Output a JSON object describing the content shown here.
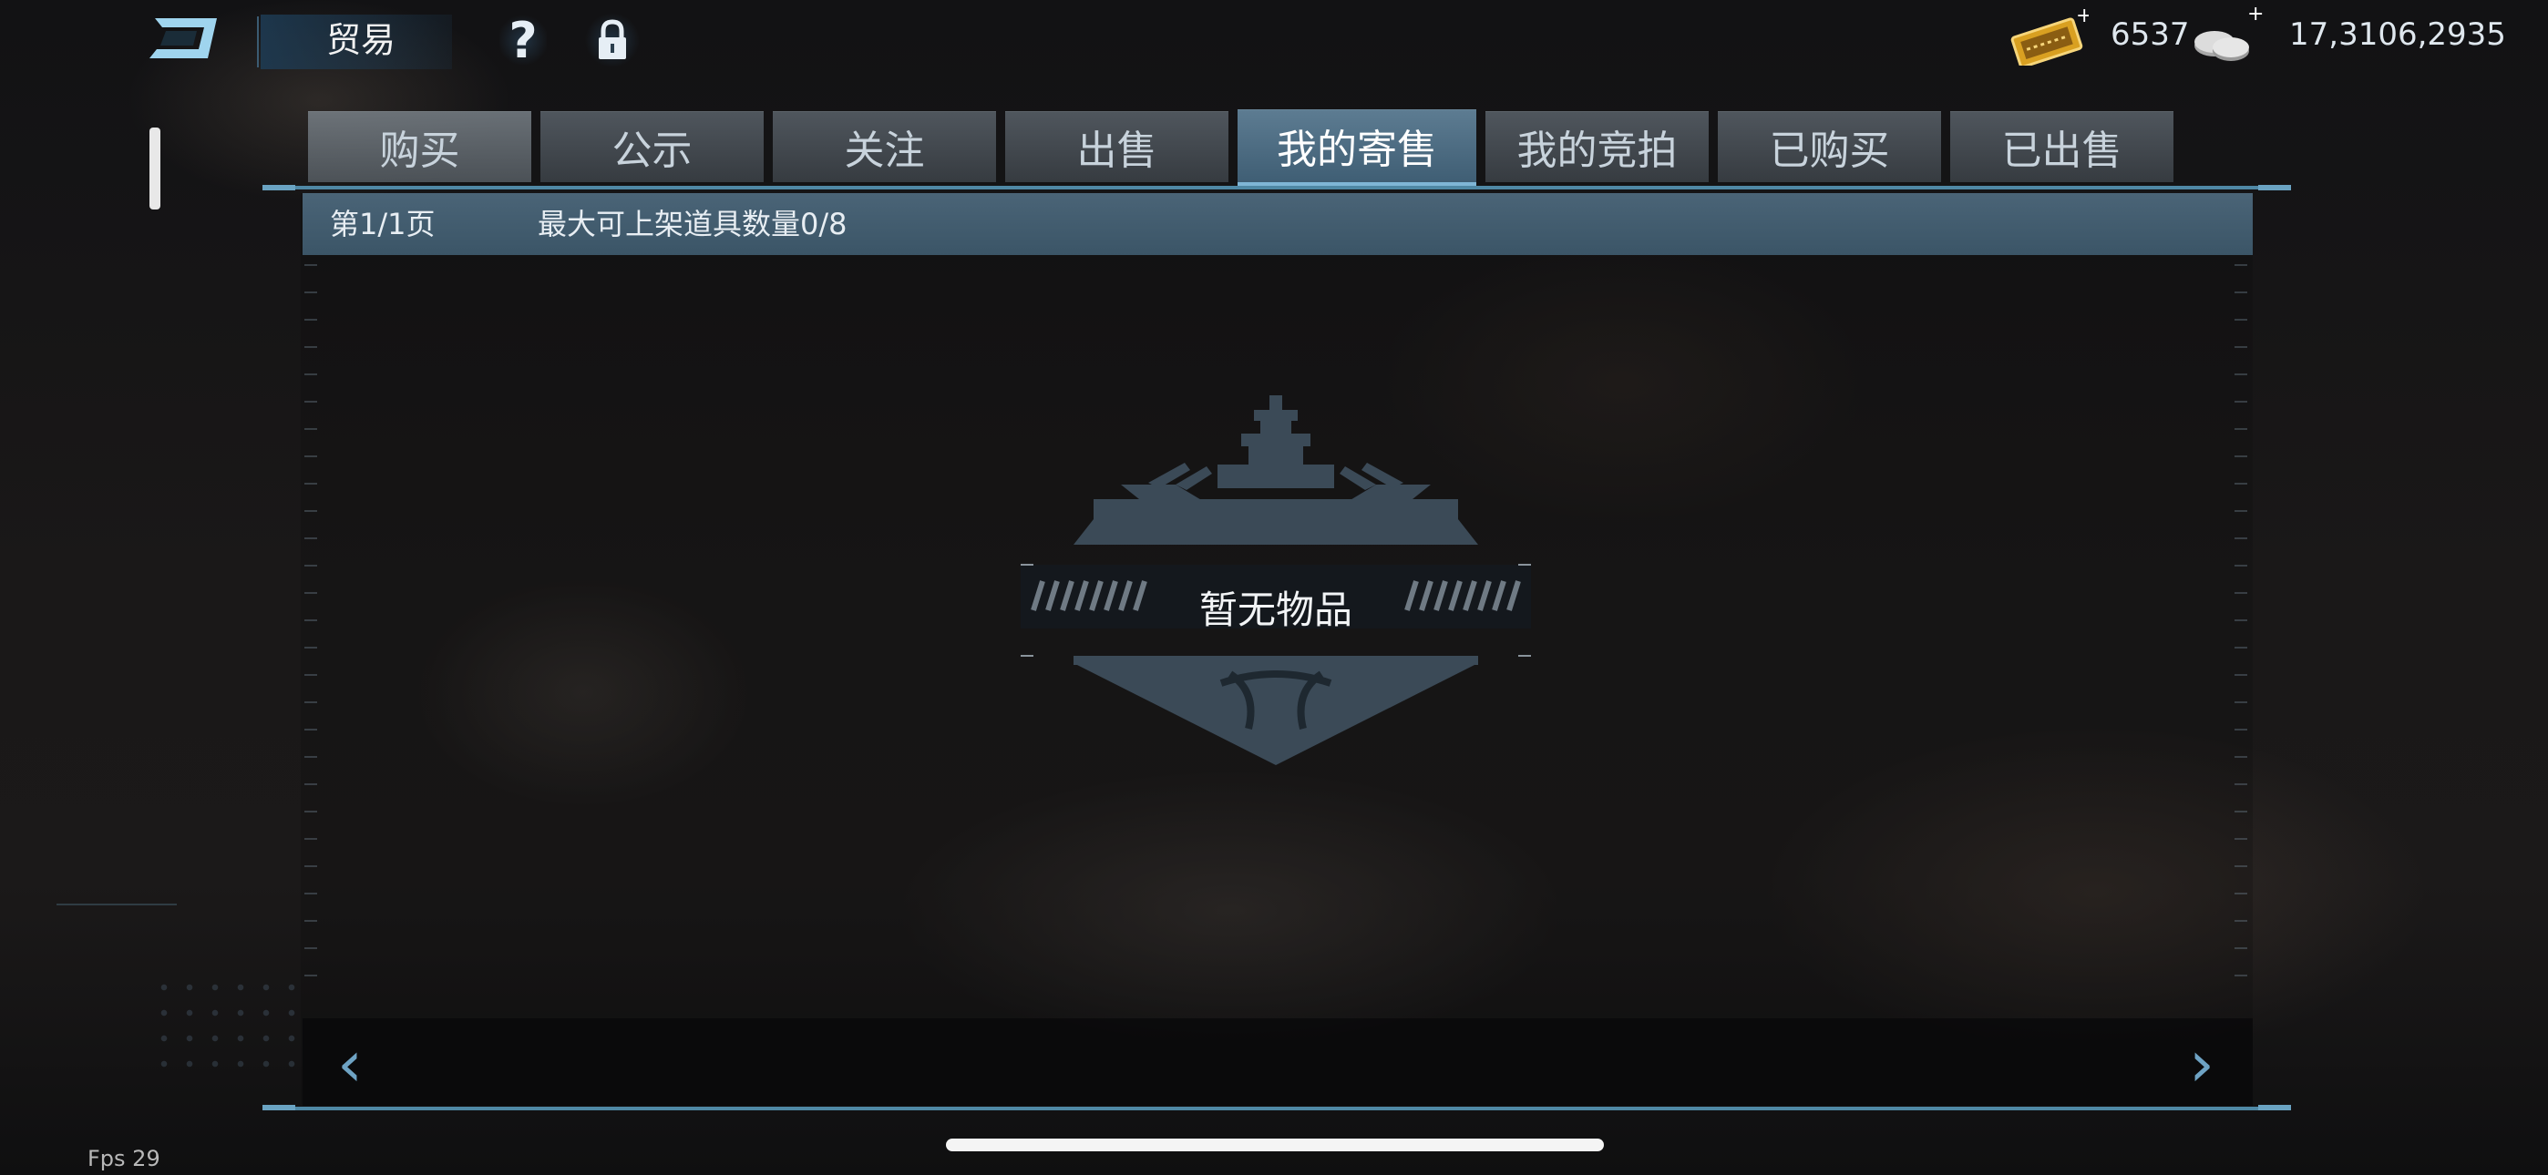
{
  "header": {
    "title": "贸易",
    "help_icon": "?"
  },
  "currency": {
    "tickets_value": "6537",
    "silver_value": "17,3106,2935"
  },
  "tabs": [
    {
      "label": "购买"
    },
    {
      "label": "公示"
    },
    {
      "label": "关注"
    },
    {
      "label": "出售"
    },
    {
      "label": "我的寄售"
    },
    {
      "label": "我的竞拍"
    },
    {
      "label": "已购买"
    },
    {
      "label": "已出售"
    }
  ],
  "active_tab": "我的寄售",
  "info": {
    "page": "第1/1页",
    "max_listing": "最大可上架道具数量0/8"
  },
  "empty": {
    "message": "暂无物品"
  },
  "nav": {
    "prev": "‹",
    "next": "›"
  },
  "fps": "Fps 29",
  "colors": {
    "accent": "#4f88a5",
    "active_tab": "#4d6d84",
    "gold_ticket": "#d9a021"
  }
}
